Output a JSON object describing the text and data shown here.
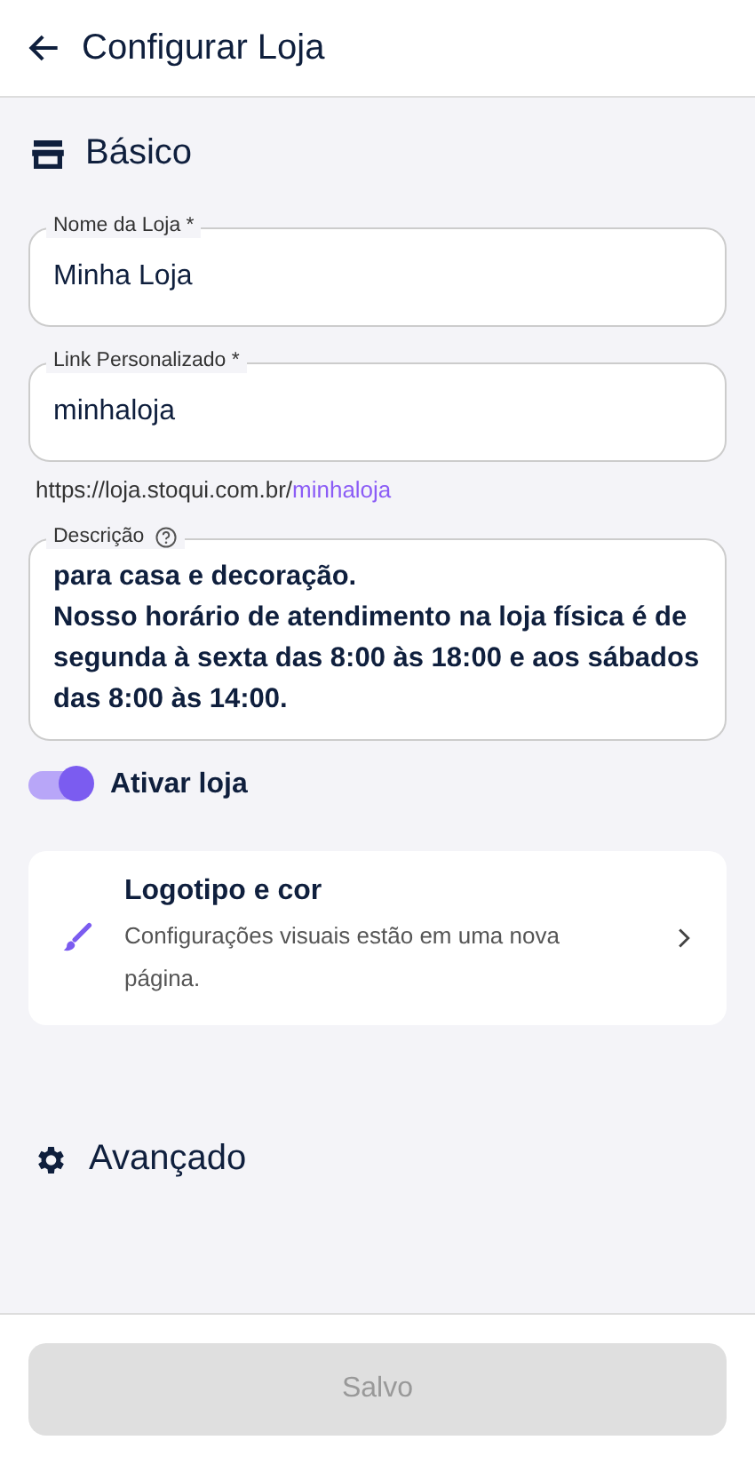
{
  "header": {
    "title": "Configurar Loja"
  },
  "basic": {
    "title": "Básico",
    "fields": [
      {
        "label": "Nome da Loja *",
        "value": "Minha Loja"
      },
      {
        "label": "Link Personalizado *",
        "value": "minhaloja"
      }
    ],
    "link_preview": {
      "base": "https://loja.stoqui.com.br/",
      "slug": "minhaloja"
    },
    "description": {
      "label": "Descrição",
      "value": "para casa e decoração.\nNosso horário de atendimento na loja física é de segunda à sexta das 8:00 às 18:00 e aos sábados das 8:00 às 14:00."
    },
    "toggle": {
      "label": "Ativar loja",
      "on": true
    },
    "link_card": {
      "title": "Logotipo e cor",
      "subtitle": "Configurações visuais estão em uma nova página."
    }
  },
  "advanced": {
    "title": "Avançado"
  },
  "footer": {
    "button": {
      "label": "Salvo",
      "disabled": true
    }
  }
}
